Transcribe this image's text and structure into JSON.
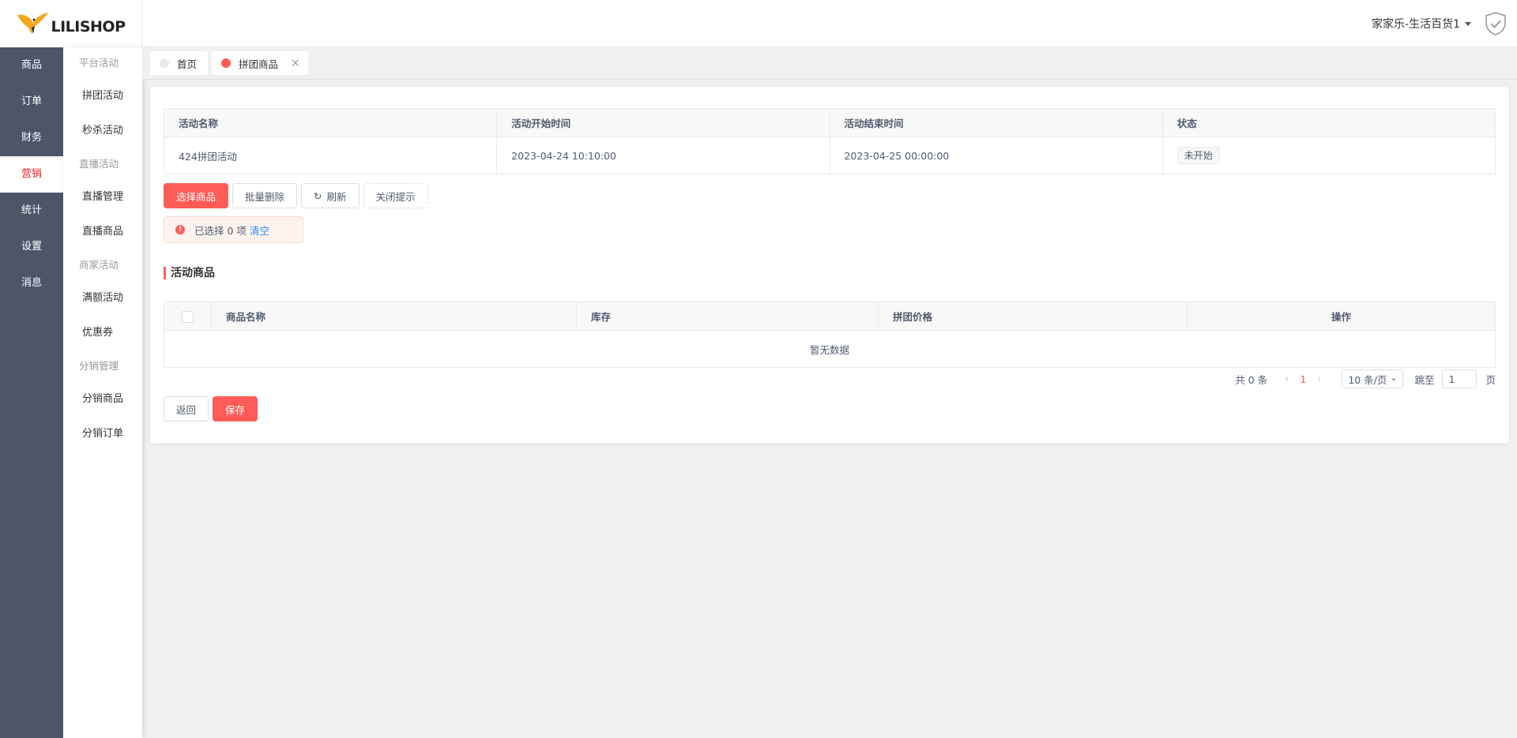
{
  "logo": {
    "text": "LILISHOP"
  },
  "primary_nav": [
    {
      "label": "商品",
      "active": false
    },
    {
      "label": "订单",
      "active": false
    },
    {
      "label": "财务",
      "active": false
    },
    {
      "label": "营销",
      "active": true
    },
    {
      "label": "统计",
      "active": false
    },
    {
      "label": "设置",
      "active": false
    },
    {
      "label": "消息",
      "active": false
    }
  ],
  "secondary_nav": {
    "groups": [
      {
        "title": "平台活动",
        "items": [
          "拼团活动",
          "秒杀活动"
        ]
      },
      {
        "title": "直播活动",
        "items": [
          "直播管理",
          "直播商品"
        ]
      },
      {
        "title": "商家活动",
        "items": [
          "满额活动",
          "优惠券"
        ]
      },
      {
        "title": "分销管理",
        "items": [
          "分销商品",
          "分销订单"
        ]
      }
    ]
  },
  "header": {
    "store_name": "家家乐-生活百货1"
  },
  "tabs": [
    {
      "label": "首页",
      "dot_color": "#e8eaec",
      "closable": false
    },
    {
      "label": "拼团商品",
      "dot_color": "#ff5c58",
      "closable": true,
      "close_glyph": "×"
    }
  ],
  "activity_table": {
    "columns": [
      "活动名称",
      "活动开始时间",
      "活动结束时间",
      "状态"
    ],
    "row": {
      "name": "424拼团活动",
      "start": "2023-04-24 10:10:00",
      "end": "2023-04-25 00:00:00",
      "status": "未开始"
    }
  },
  "toolbar": {
    "select_goods": "选择商品",
    "batch_delete": "批量删除",
    "refresh": "刷新",
    "refresh_icon": "↻",
    "close_tip": "关闭提示"
  },
  "alert": {
    "icon": "!",
    "text": "已选择 0 项",
    "clear_link": "清空"
  },
  "section": {
    "title": "活动商品"
  },
  "goods_table": {
    "columns": [
      "商品名称",
      "库存",
      "拼团价格",
      "操作"
    ],
    "empty_text": "暂无数据"
  },
  "pagination": {
    "total_text": "共 0 条",
    "prev_icon": "‹",
    "current_page": "1",
    "next_icon": "›",
    "page_size": "10 条/页",
    "page_size_caret": "⌄",
    "jump_label": "跳至",
    "jump_value": "1",
    "suffix": "页"
  },
  "footer": {
    "back": "返回",
    "save": "保存"
  },
  "colors": {
    "accent": "#ff5c58",
    "sidebar": "#4d5569",
    "link": "#2d8cf0"
  }
}
